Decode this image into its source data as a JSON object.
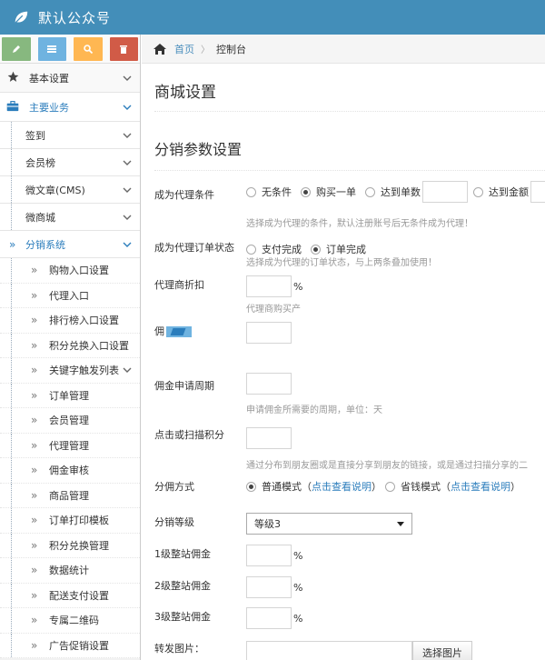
{
  "app": {
    "title": "默认公众号"
  },
  "shortcuts": [
    {
      "name": "pencil-icon",
      "color": "#87b87f"
    },
    {
      "name": "list-icon",
      "color": "#6fb3e0"
    },
    {
      "name": "search-icon",
      "color": "#ffb752"
    },
    {
      "name": "trash-icon",
      "color": "#d15b47"
    }
  ],
  "sidebar": {
    "top_items": [
      {
        "label": "基本设置",
        "icon": "star-icon"
      },
      {
        "label": "主要业务",
        "icon": "briefcase-icon"
      }
    ],
    "sub_items": [
      "签到",
      "会员榜",
      "微文章(CMS)",
      "微商城",
      "分销系统"
    ],
    "subsub_items": [
      "购物入口设置",
      "代理入口",
      "排行榜入口设置",
      "积分兑换入口设置",
      "关键字触发列表",
      "订单管理",
      "会员管理",
      "代理管理",
      "佣金审核",
      "商品管理",
      "订单打印模板",
      "积分兑换管理",
      "数据统计",
      "配送支付设置",
      "专属二维码",
      "广告促销设置"
    ]
  },
  "breadcrumb": {
    "home": "首页",
    "current": "控制台"
  },
  "page": {
    "title": "商城设置",
    "section": "分销参数设置"
  },
  "form": {
    "agent_condition": {
      "label": "成为代理条件",
      "options": [
        "无条件",
        "购买一单",
        "达到单数",
        "达到金额"
      ],
      "selected": "购买一单",
      "help": "选择成为代理的条件，默认注册账号后无条件成为代理！"
    },
    "agent_order_state": {
      "label": "成为代理订单状态",
      "options": [
        "支付完成",
        "订单完成"
      ],
      "selected": "订单完成",
      "help": "选择成为代理的订单状态，与上两条叠加使用！"
    },
    "agent_discount": {
      "label": "代理商折扣",
      "unit": "%",
      "help": "代理商购买产"
    },
    "commission": {
      "label": "佣"
    },
    "commission_period": {
      "label": "佣金申请周期",
      "help": "申请佣金所需要的周期，单位：天"
    },
    "scan_points": {
      "label": "点击或扫描积分",
      "help": "通过分布到朋友圈或是直接分享到朋友的链接，或是通过扫描分享的二"
    },
    "mode": {
      "label": "分佣方式",
      "option1": "普通模式",
      "option2": "省钱模式",
      "see_link": "点击查看说明",
      "paren_open": "（",
      "paren_close": "）",
      "selected": "普通模式"
    },
    "level": {
      "label": "分销等级",
      "value": "等级3"
    },
    "level1": {
      "label": "1级整站佣金",
      "unit": "%"
    },
    "level2": {
      "label": "2级整站佣金",
      "unit": "%"
    },
    "level3": {
      "label": "3级整站佣金",
      "unit": "%"
    },
    "share_image": {
      "label": "转发图片：",
      "button": "选择图片"
    }
  },
  "colors": {
    "topbar": "#438eb9",
    "link": "#2b7dbc"
  }
}
